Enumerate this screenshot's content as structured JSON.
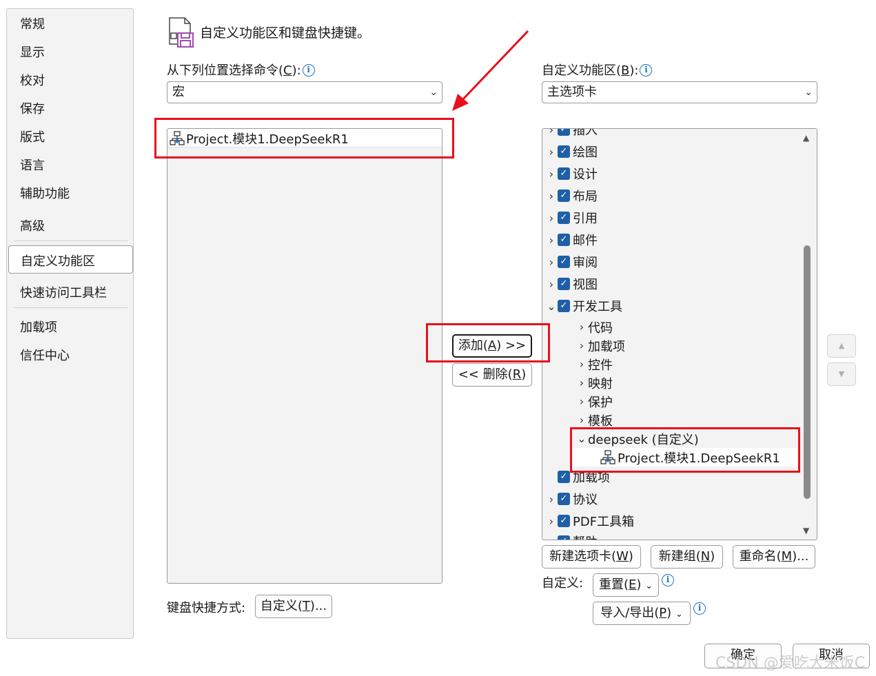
{
  "sidebar": {
    "items": [
      {
        "label": "常规"
      },
      {
        "label": "显示"
      },
      {
        "label": "校对"
      },
      {
        "label": "保存"
      },
      {
        "label": "版式"
      },
      {
        "label": "语言"
      },
      {
        "label": "辅助功能"
      },
      {
        "label": "高级"
      },
      {
        "label": "自定义功能区"
      },
      {
        "label": "快速访问工具栏"
      },
      {
        "label": "加载项"
      },
      {
        "label": "信任中心"
      }
    ]
  },
  "header": {
    "title": "自定义功能区和键盘快捷键。"
  },
  "left_panel": {
    "label_prefix": "从下列位置选择命令(",
    "label_key": "C",
    "label_suffix": "):",
    "combo_value": "宏",
    "list_items": [
      {
        "label": "Project.模块1.DeepSeekR1"
      }
    ],
    "keyboard_label": "键盘快捷方式:",
    "customize_btn_prefix": "自定义(",
    "customize_btn_key": "T",
    "customize_btn_suffix": ")..."
  },
  "middle": {
    "add_prefix": "添加(",
    "add_key": "A",
    "add_suffix": ") >>",
    "remove_prefix": "<< 删除(",
    "remove_key": "R",
    "remove_suffix": ")"
  },
  "right_panel": {
    "label_prefix": "自定义功能区(",
    "label_key": "B",
    "label_suffix": "):",
    "combo_value": "主选项卡",
    "tree": {
      "partial_top": "插入",
      "tabs": [
        "绘图",
        "设计",
        "布局",
        "引用",
        "邮件",
        "审阅",
        "视图"
      ],
      "dev_tab": "开发工具",
      "dev_groups": [
        "代码",
        "加载项",
        "控件",
        "映射",
        "保护",
        "模板"
      ],
      "custom_group": "deepseek (自定义)",
      "custom_command": "Project.模块1.DeepSeekR1",
      "after_tabs": [
        "加载项",
        "协议",
        "PDF工具箱"
      ],
      "partial_bottom": "帮助"
    },
    "new_tab_prefix": "新建选项卡(",
    "new_tab_key": "W",
    "new_tab_suffix": ")",
    "new_group_prefix": "新建组(",
    "new_group_key": "N",
    "new_group_suffix": ")",
    "rename_prefix": "重命名(",
    "rename_key": "M",
    "rename_suffix": ")...",
    "customize_label": "自定义:",
    "reset_prefix": "重置(",
    "reset_key": "E",
    "reset_suffix": ")",
    "import_prefix": "导入/导出(",
    "import_key": "P",
    "import_suffix": ")"
  },
  "footer": {
    "ok": "确定",
    "cancel": "取消"
  },
  "watermark": "CSDN @爱吃大米饭C",
  "colors": {
    "annotation_red": "#e8101a",
    "checkbox_blue": "#1f5fa8",
    "info_blue": "#1a73c8"
  }
}
